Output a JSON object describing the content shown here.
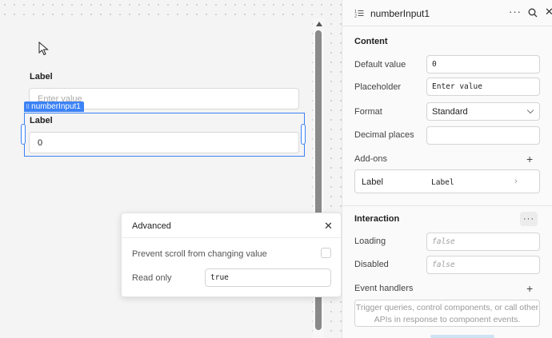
{
  "canvas": {
    "label_1": "Label",
    "input_1_placeholder": "Enter value",
    "selected_tag": "numberInput1",
    "label_2": "Label",
    "input_2_value": "0"
  },
  "advanced": {
    "title": "Advanced",
    "prevent_scroll_label": "Prevent scroll from changing value",
    "read_only_label": "Read only",
    "read_only_value": "true"
  },
  "inspector": {
    "component_name": "numberInput1",
    "more": "···",
    "close": "✕",
    "content_title": "Content",
    "default_value_label": "Default value",
    "default_value": "0",
    "placeholder_label": "Placeholder",
    "placeholder_value": "Enter value",
    "format_label": "Format",
    "format_value": "Standard",
    "decimal_places_label": "Decimal places",
    "decimal_places_value": "",
    "addons_label": "Add-ons",
    "addon_key": "Label",
    "addon_value": "Label",
    "interaction_title": "Interaction",
    "loading_label": "Loading",
    "loading_placeholder": "false",
    "disabled_label": "Disabled",
    "disabled_placeholder": "false",
    "event_handlers_label": "Event handlers",
    "event_handlers_hint": "Trigger queries, control components, or call other APIs in response to component events."
  },
  "colors": {
    "accent": "#3b82f6",
    "panel_bg": "#fafafa",
    "canvas_bg": "#f4f4f4"
  },
  "icons": [
    "cursor-arrow-icon",
    "number-input-icon",
    "more-icon",
    "search-icon",
    "close-icon",
    "chevron-down-icon",
    "chevron-right-icon",
    "plus-icon",
    "drag-grip-icon"
  ]
}
